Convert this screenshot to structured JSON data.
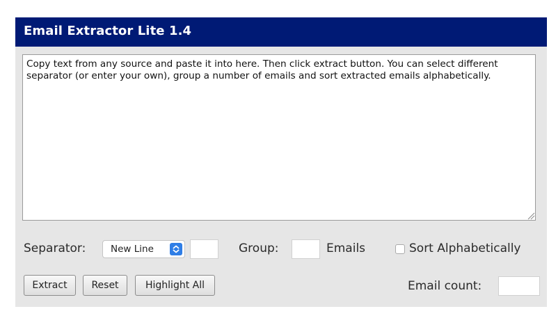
{
  "app": {
    "title": "Email Extractor Lite 1.4"
  },
  "input": {
    "text": "Copy text from any source and paste it into here. Then click extract button. You can select different separator (or enter your own), group a number of emails and sort extracted emails alphabetically."
  },
  "options": {
    "separator_label": "Separator:",
    "separator_value": "New Line",
    "custom_separator_value": "",
    "group_label": "Group:",
    "group_value": "",
    "emails_label": "Emails",
    "sort_label": "Sort Alphabetically",
    "sort_checked": false
  },
  "actions": {
    "extract_label": "Extract",
    "reset_label": "Reset",
    "highlight_label": "Highlight All"
  },
  "result": {
    "count_label": "Email count:",
    "count_value": ""
  },
  "icons": {
    "select_arrow": "chevron-up-down-icon",
    "resize": "resize-grip-icon"
  },
  "colors": {
    "title_bar": "#001a75",
    "panel": "#e6e6e6",
    "select_accent": "#2f7ee6"
  }
}
